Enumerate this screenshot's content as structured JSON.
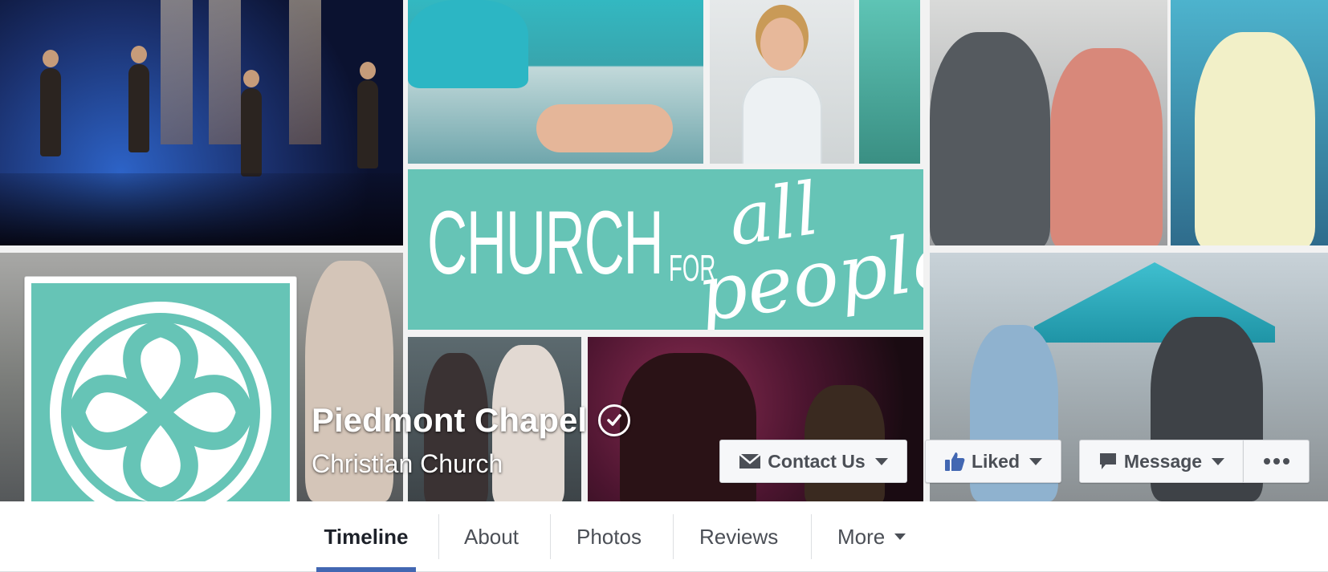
{
  "cover": {
    "banner_line1": "CHURCH",
    "banner_for": "FOR",
    "banner_all": "all",
    "banner_people": "people"
  },
  "page": {
    "name": "Piedmont Chapel",
    "category": "Christian Church"
  },
  "actions": {
    "contact_label": "Contact Us",
    "liked_label": "Liked",
    "message_label": "Message"
  },
  "tabs": [
    {
      "label": "Timeline",
      "active": true
    },
    {
      "label": "About"
    },
    {
      "label": "Photos"
    },
    {
      "label": "Reviews"
    },
    {
      "label": "More"
    }
  ],
  "colors": {
    "brand_teal": "#66c4b6",
    "facebook_blue": "#4267b2"
  }
}
